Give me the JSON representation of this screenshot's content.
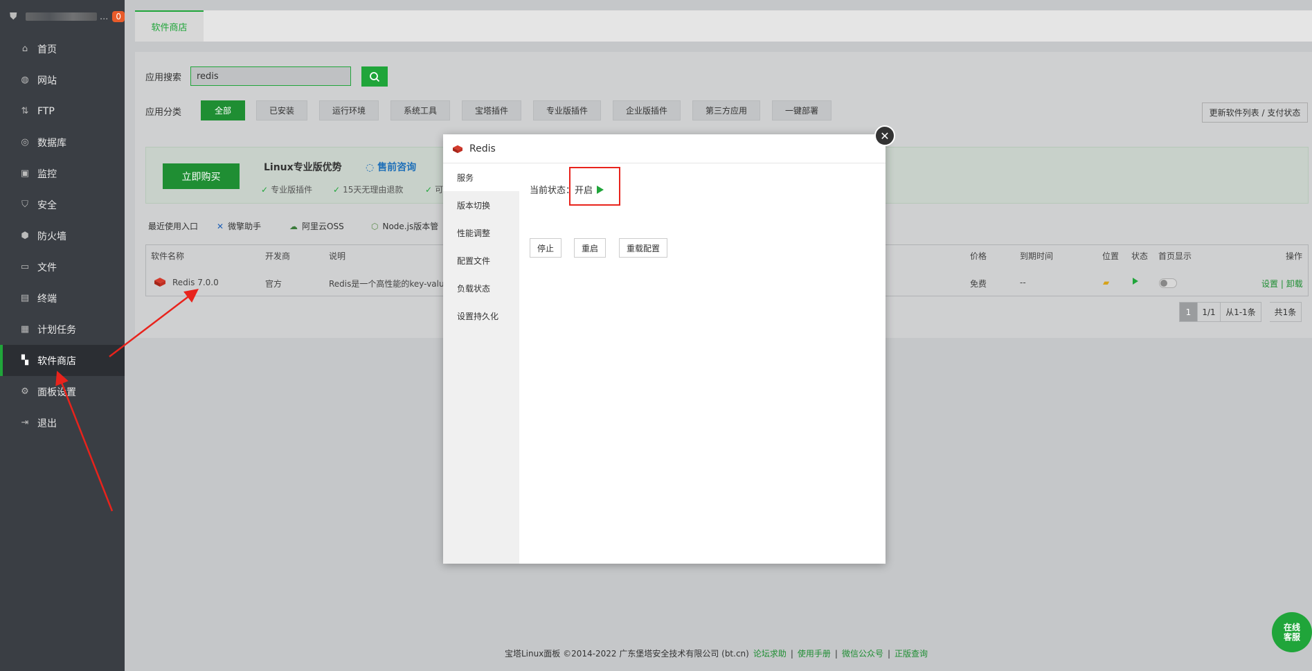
{
  "sidebar": {
    "badge": "0",
    "dots": "...",
    "items": [
      {
        "label": "首页",
        "icon": "home-icon"
      },
      {
        "label": "网站",
        "icon": "globe-icon"
      },
      {
        "label": "FTP",
        "icon": "ftp-icon"
      },
      {
        "label": "数据库",
        "icon": "database-icon"
      },
      {
        "label": "监控",
        "icon": "monitor-icon"
      },
      {
        "label": "安全",
        "icon": "shield-icon"
      },
      {
        "label": "防火墙",
        "icon": "firewall-icon"
      },
      {
        "label": "文件",
        "icon": "folder-icon"
      },
      {
        "label": "终端",
        "icon": "terminal-icon"
      },
      {
        "label": "计划任务",
        "icon": "calendar-icon"
      },
      {
        "label": "软件商店",
        "icon": "grid-icon"
      },
      {
        "label": "面板设置",
        "icon": "gear-icon"
      },
      {
        "label": "退出",
        "icon": "logout-icon"
      }
    ]
  },
  "main": {
    "tab": "软件商店",
    "search_label": "应用搜索",
    "search_value": "redis",
    "category_label": "应用分类",
    "categories": [
      "全部",
      "已安装",
      "运行环境",
      "系统工具",
      "宝塔插件",
      "专业版插件",
      "企业版插件",
      "第三方应用",
      "一键部署"
    ],
    "update_button": "更新软件列表 / 支付状态",
    "promo": {
      "buy": "立即购买",
      "title": "Linux专业版优势",
      "consult": "售前咨询",
      "features": [
        "专业版插件",
        "15天无理由退款",
        "可"
      ]
    },
    "recent": {
      "label": "最近使用入口",
      "items": [
        "微擎助手",
        "阿里云OSS",
        "Node.js版本管"
      ]
    },
    "table": {
      "headers": [
        "软件名称",
        "开发商",
        "说明",
        "价格",
        "到期时间",
        "位置",
        "状态",
        "首页显示",
        "操作"
      ],
      "row": {
        "name": "Redis 7.0.0",
        "developer": "官方",
        "desc": "Redis是一个高性能的key-value",
        "price": "免费",
        "expire": "--",
        "settings": "设置",
        "sep": "|",
        "uninstall": "卸载"
      }
    },
    "pager": [
      "1",
      "1/1",
      "从1-1条",
      "共1条"
    ]
  },
  "footer": {
    "copyright": "宝塔Linux面板 ©2014-2022 广东堡塔安全技术有限公司 (bt.cn)",
    "links": [
      "论坛求助",
      "使用手册",
      "微信公众号",
      "正版查询"
    ],
    "sep": "|"
  },
  "chat": {
    "line1": "在线",
    "line2": "客服"
  },
  "modal": {
    "title": "Redis",
    "tabs": [
      "服务",
      "版本切换",
      "性能调整",
      "配置文件",
      "负载状态",
      "设置持久化"
    ],
    "status_label": "当前状态：",
    "status_value": "开启",
    "buttons": [
      "停止",
      "重启",
      "重载配置"
    ]
  },
  "colors": {
    "accent": "#20a53a",
    "highlight": "#e8231c",
    "sidebar": "#3a3e44"
  }
}
